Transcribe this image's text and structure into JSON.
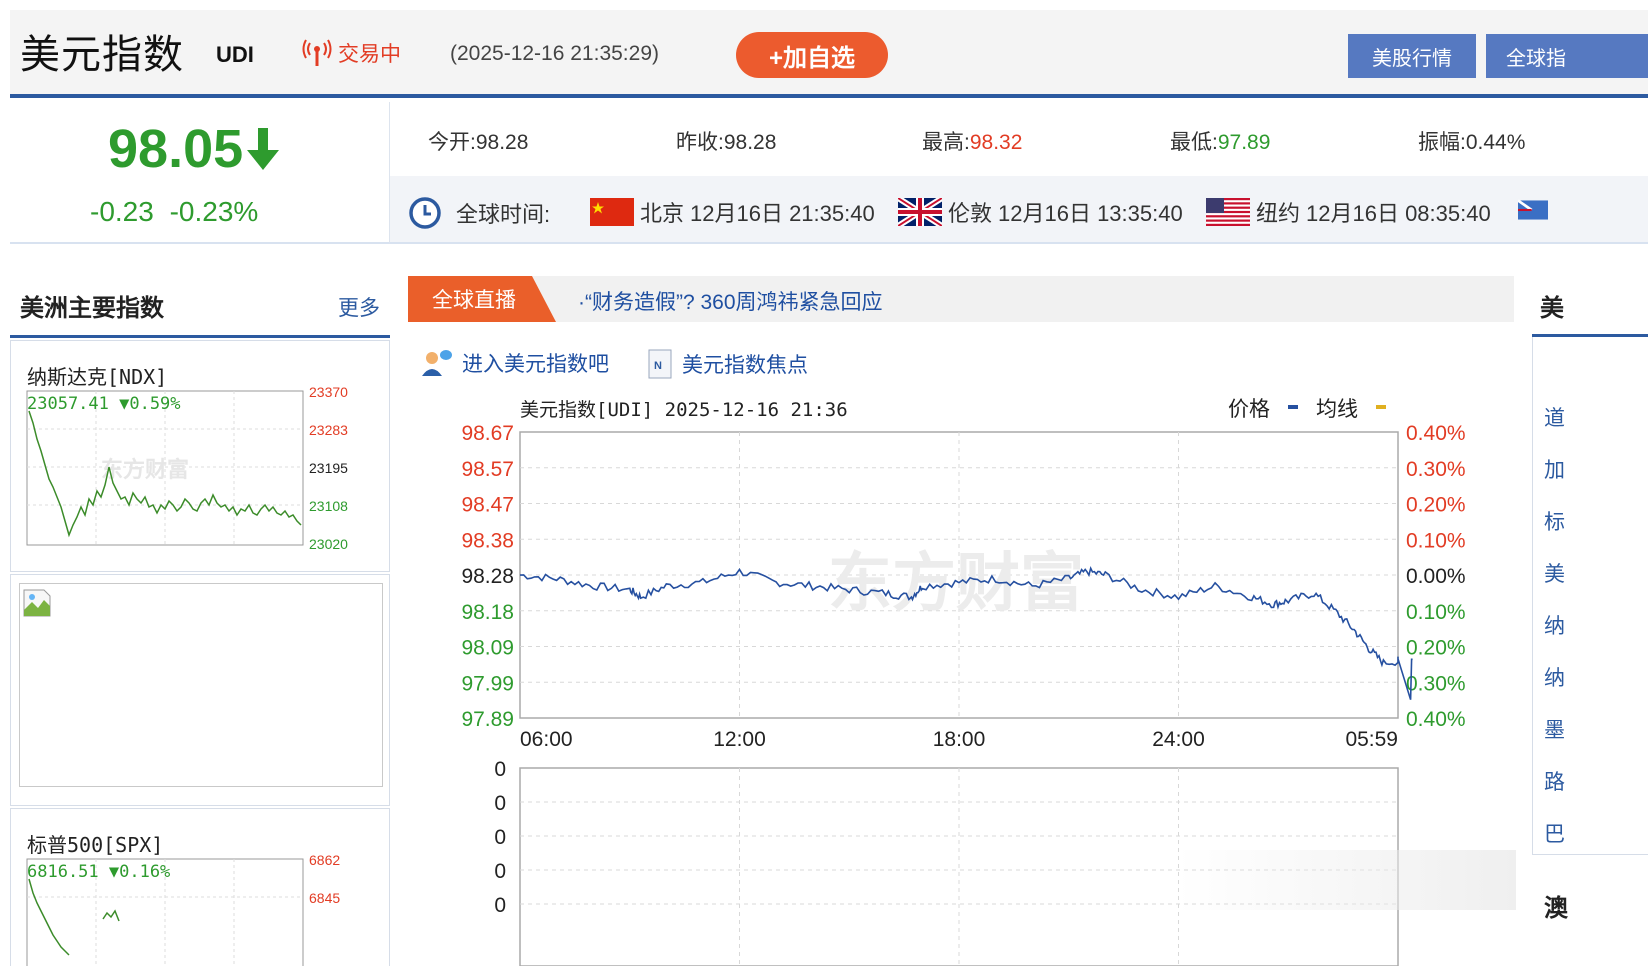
{
  "header": {
    "title": "美元指数",
    "code": "UDI",
    "status": "交易中",
    "datetime": "(2025-12-16 21:35:29)",
    "add_label": "+加自选",
    "nav": [
      "美股行情",
      "全球指"
    ]
  },
  "quote": {
    "price": "98.05",
    "change": "-0.23",
    "change_pct": "-0.23%",
    "stats": [
      {
        "label": "今开:",
        "value": "98.28",
        "color": "#333333"
      },
      {
        "label": "昨收:",
        "value": "98.28",
        "color": "#333333"
      },
      {
        "label": "最高:",
        "value": "98.32",
        "color": "#e23c24"
      },
      {
        "label": "最低:",
        "value": "97.89",
        "color": "#2e9b2e"
      },
      {
        "label": "振幅:",
        "value": "0.44%",
        "color": "#333333"
      }
    ]
  },
  "clocks": {
    "label": "全球时间:",
    "items": [
      {
        "city": "北京",
        "time": "12月16日 21:35:40"
      },
      {
        "city": "伦敦",
        "time": "12月16日 13:35:40"
      },
      {
        "city": "纽约",
        "time": "12月16日 08:35:40"
      }
    ]
  },
  "left": {
    "title": "美洲主要指数",
    "more": "更多",
    "nasdaq": {
      "name": "纳斯达克[NDX]",
      "quote": "23057.41 ▼0.59%",
      "axis": [
        "23370",
        "23283",
        "23195",
        "23108",
        "23020"
      ],
      "watermark": "东方财富"
    },
    "spx": {
      "name": "标普500[SPX]",
      "quote": "6816.51 ▼0.16%",
      "axis": [
        "6862",
        "6845"
      ]
    }
  },
  "live": {
    "tag": "全球直播",
    "news": "·“财务造假”? 360周鸿祎紧急回应"
  },
  "links": {
    "bar": "进入美元指数吧",
    "focus": "美元指数焦点"
  },
  "chart_data": {
    "type": "line",
    "title": "美元指数[UDI] 2025-12-16 21:36",
    "legend": [
      {
        "name": "价格",
        "color": "#2650a0"
      },
      {
        "name": "均线",
        "color": "#e0b020"
      }
    ],
    "ylim": [
      97.89,
      98.67
    ],
    "y_ticks": [
      "98.67",
      "98.57",
      "98.47",
      "98.38",
      "98.28",
      "98.18",
      "98.09",
      "97.99",
      "97.89"
    ],
    "pct_ticks": [
      "0.40%",
      "0.30%",
      "0.20%",
      "0.10%",
      "0.00%",
      "0.10%",
      "0.20%",
      "0.30%",
      "0.40%"
    ],
    "x_ticks": [
      "06:00",
      "12:00",
      "18:00",
      "24:00",
      "05:59"
    ],
    "x_hours": [
      0,
      1,
      2,
      3,
      3.3,
      4,
      5,
      6,
      7,
      8,
      9,
      10,
      10.7,
      11,
      12,
      13,
      14,
      15,
      15.5,
      16,
      17,
      18,
      19,
      20,
      20.6,
      21,
      21.7,
      22.3,
      22.8,
      23.2,
      23.6,
      24.4
    ],
    "values": [
      98.28,
      98.27,
      98.25,
      98.24,
      98.22,
      98.25,
      98.26,
      98.29,
      98.26,
      98.25,
      98.24,
      98.23,
      98.22,
      98.25,
      98.26,
      98.27,
      98.25,
      98.27,
      98.29,
      98.28,
      98.24,
      98.22,
      98.25,
      98.22,
      98.2,
      98.21,
      98.23,
      98.18,
      98.13,
      98.08,
      98.04,
      98.05
    ],
    "watermark": "东方财富",
    "volume_ticks": [
      "0",
      "0",
      "0",
      "0",
      "0"
    ]
  },
  "right": {
    "head": "美",
    "items": [
      "道",
      "加",
      "标",
      "美",
      "纳",
      "纳",
      "墨",
      "路",
      "巴"
    ],
    "next": "澳"
  }
}
